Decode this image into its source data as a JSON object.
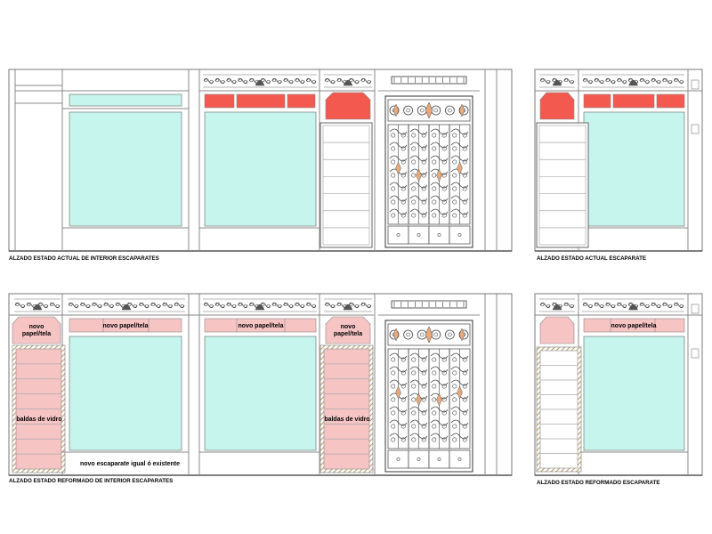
{
  "captions": {
    "top_left": "ALZADO ESTADO ACTUAL DE INTERIOR ESCAPARATES",
    "top_right": "ALZADO ESTADO ACTUAL ESCAPARATE",
    "bottom_left": "ALZADO ESTADO REFORMADO DE INTERIOR ESCAPARATES",
    "bottom_right": "ALZADO ESTADO REFORMADO ESCAPARATE"
  },
  "notes": {
    "novo_papel": "novo papel/tela",
    "novo_papel_l1": "novo",
    "novo_papel_l2": "papel/tela",
    "baldas": "baldas de vidro",
    "novo_escaparate": "novo escaparate igual ó existente"
  },
  "colors": {
    "glass": "#c5f5ec",
    "red_existing": "#f4594f",
    "pink_new": "#f7c4c4",
    "hatch": "#b59a62",
    "line": "#6f6f6f",
    "dark": "#333333",
    "ornament": "#555555",
    "orange_accent": "#e8a97c",
    "grille": "#444444"
  }
}
